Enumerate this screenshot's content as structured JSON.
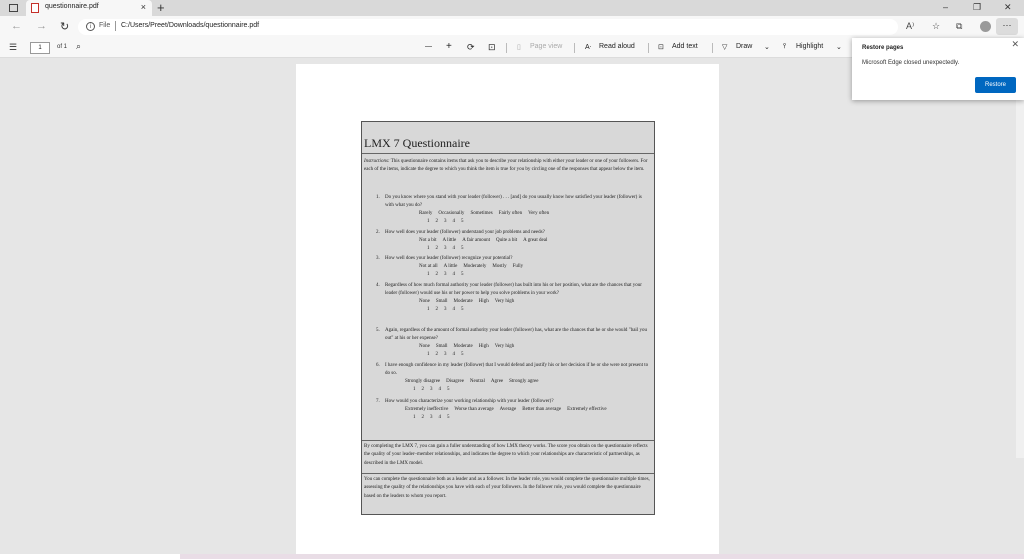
{
  "browser": {
    "tab": {
      "title": "questionnaire.pdf",
      "close": "×"
    },
    "new_tab": "+",
    "window_controls": {
      "minimize": "–",
      "restore": "❐",
      "close": "✕"
    },
    "nav": {
      "back": "←",
      "forward": "→",
      "reload": "↻"
    },
    "address": {
      "info": "i",
      "scheme_label": "File",
      "url": "C:/Users/Preet/Downloads/questionnaire.pdf"
    },
    "toolbar_icons": {
      "read_aloud": "A⁾",
      "favorites": "☆",
      "collections": "⧉",
      "more": "···"
    }
  },
  "pdf_toolbar": {
    "toc": "☰",
    "page_current": "1",
    "page_of": "of 1",
    "search": "⌕",
    "zoom_out": "—",
    "zoom_in": "+",
    "rotate": "⟳",
    "fit": "⊡",
    "page_view": "Page view",
    "read_aloud": "Read aloud",
    "add_text": "Add text",
    "draw": "Draw",
    "highlight": "Highlight",
    "chevron": "⌄"
  },
  "popup": {
    "title": "Restore pages",
    "message": "Microsoft Edge closed unexpectedly.",
    "button": "Restore",
    "close": "✕"
  },
  "document": {
    "title": "LMX 7 Questionnaire",
    "instructions_label": "Instructions:",
    "instructions": "This questionnaire contains items that ask you to describe your relationship with either your leader or one of your followers. For each of the items, indicate the degree to which you think the item is true for you by circling one of the responses that appear below the item.",
    "items": [
      {
        "num": "1.",
        "text": "Do you know where you stand with your leader (follower) . . . [and] do you usually know how satisfied your leader (follower) is with what you do?",
        "labels": [
          "Rarely",
          "Occasionally",
          "Sometimes",
          "Fairly often",
          "Very often"
        ],
        "scale": [
          "1",
          "2",
          "3",
          "4",
          "5"
        ]
      },
      {
        "num": "2.",
        "text": "How well does your leader (follower) understand your job problems and needs?",
        "labels": [
          "Not a bit",
          "A little",
          "A fair amount",
          "Quite a bit",
          "A great deal"
        ],
        "scale": [
          "1",
          "2",
          "3",
          "4",
          "5"
        ]
      },
      {
        "num": "3.",
        "text": "How well does your leader (follower) recognize your potential?",
        "labels": [
          "Not at all",
          "A little",
          "Moderately",
          "Mostly",
          "Fully"
        ],
        "scale": [
          "1",
          "2",
          "3",
          "4",
          "5"
        ]
      },
      {
        "num": "4.",
        "text": "Regardless of how much formal authority your leader (follower) has built into his or her position, what are the chances that your leader (follower) would use his or her power to help you solve problems in your work?",
        "labels": [
          "None",
          "Small",
          "Moderate",
          "High",
          "Very high"
        ],
        "scale": [
          "1",
          "2",
          "3",
          "4",
          "5"
        ]
      },
      {
        "num": "5.",
        "text": "Again, regardless of the amount of formal authority your leader (follower) has, what are the chances that he or she would \"bail you out\" at his or her expense?",
        "labels": [
          "None",
          "Small",
          "Moderate",
          "High",
          "Very high"
        ],
        "scale": [
          "1",
          "2",
          "3",
          "4",
          "5"
        ]
      },
      {
        "num": "6.",
        "text": "I have enough confidence in my leader (follower) that I would defend and justify his or her decision if he or she were not present to do so.",
        "labels": [
          "Strongly disagree",
          "Disagree",
          "Neutral",
          "Agree",
          "Strongly agree"
        ],
        "scale": [
          "1",
          "2",
          "3",
          "4",
          "5"
        ]
      },
      {
        "num": "7.",
        "text": "How would you characterize your working relationship with your leader (follower)?",
        "labels": [
          "Extremely ineffective",
          "Worse than average",
          "Average",
          "Better than average",
          "Extremely effective"
        ],
        "scale": [
          "1",
          "2",
          "3",
          "4",
          "5"
        ]
      }
    ],
    "paragraph1": "By completing the LMX 7, you can gain a fuller understanding of how LMX theory works. The score you obtain on the questionnaire reflects the quality of your leader–member relationships, and indicates the degree to which your relationships are characteristic of partnerships, as described in the LMX model.",
    "paragraph2": "You can complete the questionnaire both as a leader and as a follower. In the leader role, you would complete the questionnaire multiple times, assessing the quality of the relationships you have with each of your followers. In the follower role, you would complete the questionnaire based on the leaders to whom you report."
  }
}
